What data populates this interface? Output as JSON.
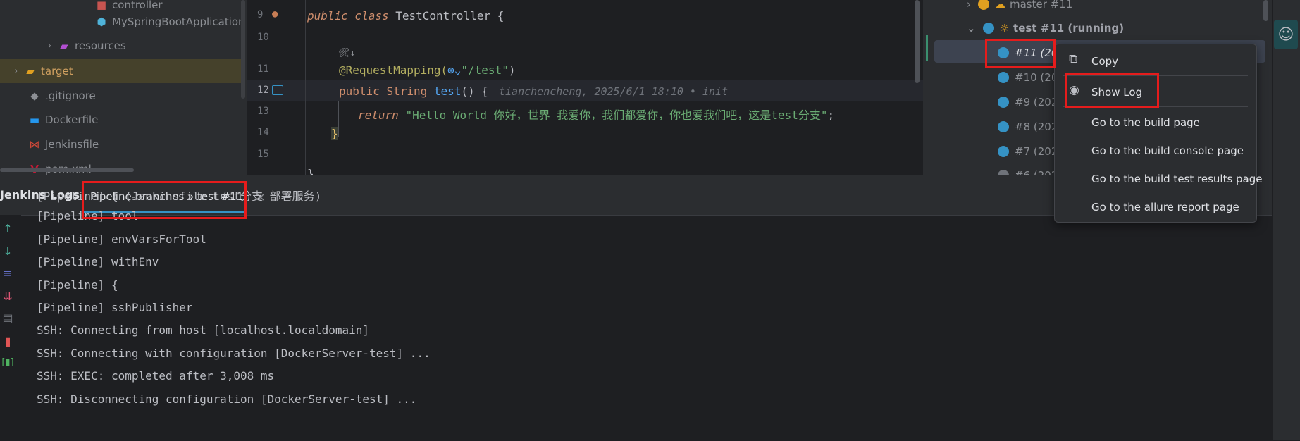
{
  "project_tree": {
    "items": [
      {
        "label": "controller"
      },
      {
        "label": "MySpringBootApplication"
      },
      {
        "label": "resources"
      },
      {
        "label": "target"
      },
      {
        "label": ".gitignore"
      },
      {
        "label": "Dockerfile"
      },
      {
        "label": "Jenkinsfile"
      },
      {
        "label": "pom.xml"
      }
    ]
  },
  "editor": {
    "line_numbers": [
      "9",
      "10",
      "11",
      "12",
      "13",
      "14",
      "15"
    ],
    "line9": {
      "kw": "public class ",
      "name": "TestController",
      "rest": " {"
    },
    "hint": "🛠↓",
    "line11": {
      "ann": "@RequestMapping(",
      "str": "\"/test\"",
      "end": ")"
    },
    "line12": {
      "kw1": "public ",
      "type": "String ",
      "fn": "test",
      "rest": "() {"
    },
    "blame": "tianchencheng, 2025/6/1 18:10 • init",
    "line13": {
      "kw": "return ",
      "str": "\"Hello World 你好，世界 我爱你，我们都爱你，你也爱我们吧，这是test分支\"",
      "end": ";"
    },
    "line14": "}",
    "line16": "}"
  },
  "builds": {
    "master": "master #11",
    "test": "test #11 (running)",
    "items": [
      "#11 (202",
      "#10 (202",
      "#9 (2025",
      "#8 (2025",
      "#7 (2025",
      "#6 (2025"
    ]
  },
  "context_menu": {
    "copy": "Copy",
    "show_log": "Show Log",
    "build_page": "Go to the build page",
    "console_page": "Go to the build console page",
    "test_results": "Go to the build test results page",
    "allure": "Go to the allure report page"
  },
  "bottom": {
    "tool_title": "Jenkins Logs",
    "tab_label": "Pipeline-branches » test #11",
    "tab_close": "×",
    "log_lines": [
      "[Pipeline] { (Jenkinsfile test分支 部署服务)",
      "[Pipeline] tool",
      "[Pipeline] envVarsForTool",
      "[Pipeline] withEnv",
      "[Pipeline] {",
      "[Pipeline] sshPublisher",
      "SSH: Connecting from host [localhost.localdomain]",
      "SSH: Connecting with configuration [DockerServer-test] ...",
      "SSH: EXEC: completed after 3,008 ms",
      "SSH: Disconnecting configuration [DockerServer-test] ..."
    ]
  },
  "icons": [
    "java-class-icon",
    "folder-icon",
    "git-icon",
    "docker-icon",
    "jenkins-icon",
    "maven-icon",
    "copy-icon",
    "eye-icon",
    "arrow-up-icon",
    "arrow-down-icon",
    "wrap-icon",
    "scroll-end-icon",
    "print-icon",
    "trash-icon"
  ],
  "colors": {
    "accent": "#3592c4",
    "highlight": "#e51c1c",
    "selected_row": "#45412b"
  }
}
